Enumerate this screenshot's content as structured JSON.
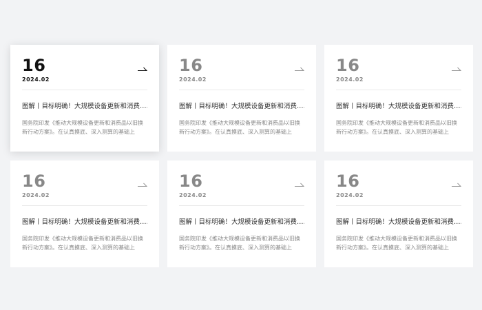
{
  "colors": {
    "page_background": "#f2f3f5",
    "card_background": "#ffffff",
    "active_text": "#111111",
    "muted_text": "#888888",
    "divider": "#e9e9e9"
  },
  "cards": [
    {
      "day": "16",
      "month": "2024.02",
      "title": "图解丨目标明确！大规模设备更新和消费……",
      "desc": "国务院印发《推动大规模设备更新和消费品以旧换新行动方案》。在认真摸底、深入测算的基础上",
      "icon": "arrow-right-icon",
      "active": true
    },
    {
      "day": "16",
      "month": "2024.02",
      "title": "图解丨目标明确！大规模设备更新和消费……",
      "desc": "国务院印发《推动大规模设备更新和消费品以旧换新行动方案》。在认真摸底、深入测算的基础上",
      "icon": "arrow-right-icon",
      "active": false
    },
    {
      "day": "16",
      "month": "2024.02",
      "title": "图解丨目标明确！大规模设备更新和消费……",
      "desc": "国务院印发《推动大规模设备更新和消费品以旧换新行动方案》。在认真摸底、深入测算的基础上",
      "icon": "arrow-right-icon",
      "active": false
    },
    {
      "day": "16",
      "month": "2024.02",
      "title": "图解丨目标明确！大规模设备更新和消费……",
      "desc": "国务院印发《推动大规模设备更新和消费品以旧换新行动方案》。在认真摸底、深入测算的基础上",
      "icon": "arrow-right-icon",
      "active": false
    },
    {
      "day": "16",
      "month": "2024.02",
      "title": "图解丨目标明确！大规模设备更新和消费……",
      "desc": "国务院印发《推动大规模设备更新和消费品以旧换新行动方案》。在认真摸底、深入测算的基础上",
      "icon": "arrow-right-icon",
      "active": false
    },
    {
      "day": "16",
      "month": "2024.02",
      "title": "图解丨目标明确！大规模设备更新和消费……",
      "desc": "国务院印发《推动大规模设备更新和消费品以旧换新行动方案》。在认真摸底、深入测算的基础上",
      "icon": "arrow-right-icon",
      "active": false
    }
  ]
}
